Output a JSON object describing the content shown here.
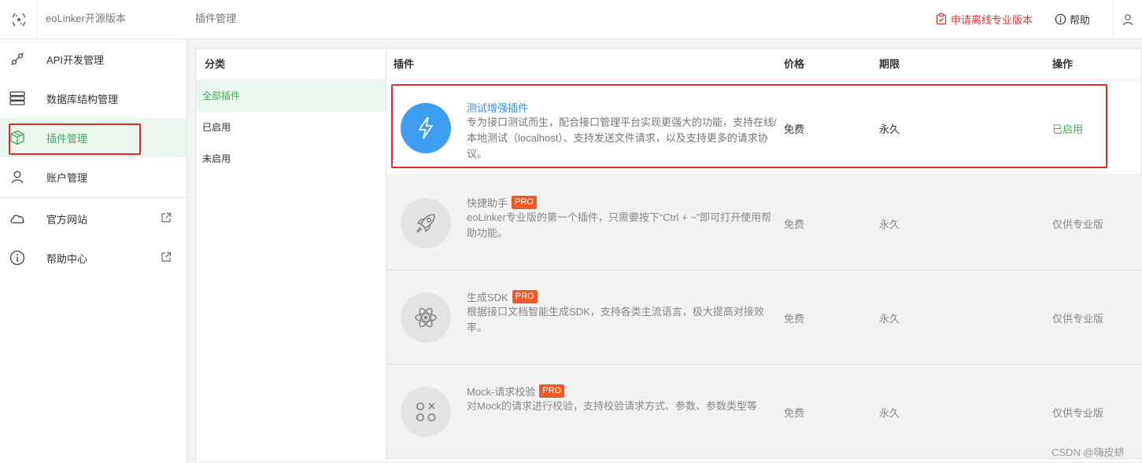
{
  "header": {
    "app_name": "eoLinker开源版本",
    "page_title": "插件管理",
    "upgrade_label": "申请离线专业版本",
    "help_label": "帮助"
  },
  "sidebar": {
    "items": [
      {
        "label": "API开发管理",
        "icon": "api-link-icon"
      },
      {
        "label": "数据库结构管理",
        "icon": "database-icon"
      },
      {
        "label": "插件管理",
        "icon": "plugin-cube-icon",
        "active": true
      },
      {
        "label": "账户管理",
        "icon": "user-icon"
      }
    ],
    "links": [
      {
        "label": "官方网站",
        "icon": "cloud-icon"
      },
      {
        "label": "帮助中心",
        "icon": "info-icon"
      }
    ]
  },
  "categories": {
    "header": "分类",
    "items": [
      {
        "label": "全部插件",
        "active": true
      },
      {
        "label": "已启用"
      },
      {
        "label": "未启用"
      }
    ]
  },
  "table": {
    "columns": {
      "plugin": "插件",
      "price": "价格",
      "term": "期限",
      "action": "操作"
    },
    "rows": [
      {
        "name": "测试增强插件",
        "pro": "",
        "desc": "专为接口测试而生，配合接口管理平台实现更强大的功能，支持在线/本地测试（localhost）、支持发送文件请求，以及支持更多的请求协议。",
        "price": "免费",
        "term": "永久",
        "action": "已启用",
        "icon": "lightning-icon",
        "icon_color": "#3d9df2"
      },
      {
        "name": "快捷助手",
        "pro": "PRO",
        "desc": "eoLinker专业版的第一个插件，只需要按下“Ctrl + ~”即可打开使用帮助功能。",
        "price": "免费",
        "term": "永久",
        "action": "仅供专业版",
        "icon": "rocket-icon"
      },
      {
        "name": "生成SDK",
        "pro": "PRO",
        "desc": "根据接口文档智能生成SDK，支持各类主流语言，极大提高对接效率。",
        "price": "免费",
        "term": "永久",
        "action": "仅供专业版",
        "icon": "atom-icon"
      },
      {
        "name": "Mock-请求校验",
        "pro": "PRO",
        "desc": "对Mock的请求进行校验，支持校验请求方式、参数、参数类型等",
        "price": "免费",
        "term": "永久",
        "action": "仅供专业版",
        "icon": "grid-check-icon"
      }
    ]
  },
  "watermark": "CSDN @嗨皮蛴",
  "colors": {
    "accent_green": "#3daa57",
    "link_blue": "#3a8ee6",
    "alert_red": "#d9373d",
    "pro_orange": "#f05a28"
  }
}
